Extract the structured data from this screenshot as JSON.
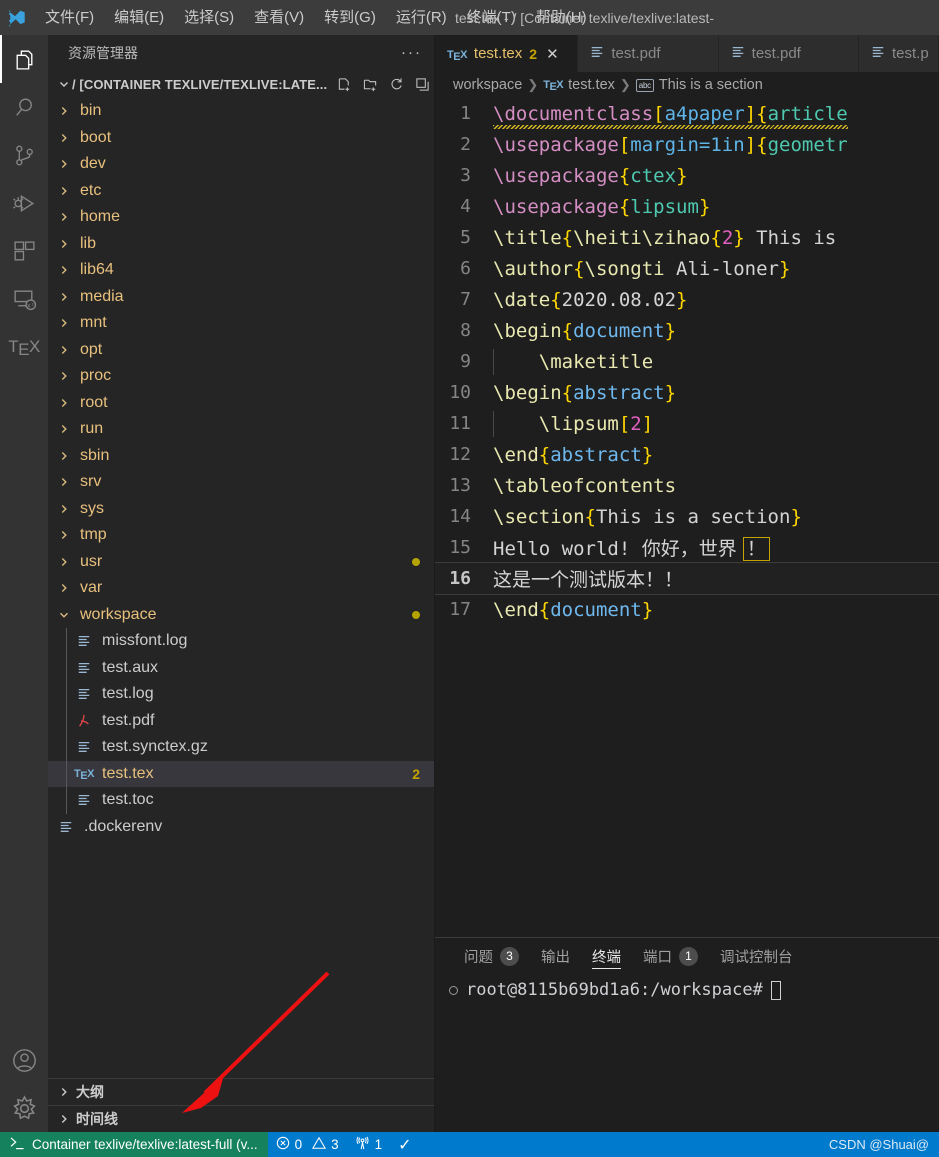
{
  "titlebar": {
    "menus": [
      {
        "label": "文件(F)",
        "mnemonic": "F"
      },
      {
        "label": "编辑(E)",
        "mnemonic": "E"
      },
      {
        "label": "选择(S)",
        "mnemonic": "S"
      },
      {
        "label": "查看(V)",
        "mnemonic": "V"
      },
      {
        "label": "转到(G)",
        "mnemonic": "G"
      },
      {
        "label": "运行(R)",
        "mnemonic": "R"
      },
      {
        "label": "终端(T)",
        "mnemonic": "T"
      },
      {
        "label": "帮助(H)",
        "mnemonic": "H"
      }
    ],
    "window_title": "test.tex - / [Container texlive/texlive:latest-"
  },
  "activitybar": {
    "items": [
      {
        "icon": "files-explorer-icon",
        "active": true
      },
      {
        "icon": "search-icon",
        "active": false
      },
      {
        "icon": "source-control-icon",
        "active": false
      },
      {
        "icon": "run-and-debug-icon",
        "active": false
      },
      {
        "icon": "extensions-icon",
        "active": false
      },
      {
        "icon": "remote-explorer-icon",
        "active": false
      },
      {
        "icon": "latex-workshop-icon",
        "active": false,
        "label": "TEX"
      }
    ],
    "bottom": [
      {
        "icon": "account-icon"
      },
      {
        "icon": "gear-icon"
      }
    ]
  },
  "sidebar": {
    "header": "资源管理器",
    "more_actions": "···",
    "root": {
      "label": "/ [CONTAINER TEXLIVE/TEXLIVE:LATE...",
      "expanded": true,
      "actions": [
        "new-file-icon",
        "new-folder-icon",
        "refresh-icon",
        "collapse-all-icon"
      ]
    },
    "tree": [
      {
        "name": "bin",
        "type": "folder",
        "expanded": false,
        "depth": 1
      },
      {
        "name": "boot",
        "type": "folder",
        "expanded": false,
        "depth": 1
      },
      {
        "name": "dev",
        "type": "folder",
        "expanded": false,
        "depth": 1
      },
      {
        "name": "etc",
        "type": "folder",
        "expanded": false,
        "depth": 1
      },
      {
        "name": "home",
        "type": "folder",
        "expanded": false,
        "depth": 1
      },
      {
        "name": "lib",
        "type": "folder",
        "expanded": false,
        "depth": 1
      },
      {
        "name": "lib64",
        "type": "folder",
        "expanded": false,
        "depth": 1
      },
      {
        "name": "media",
        "type": "folder",
        "expanded": false,
        "depth": 1
      },
      {
        "name": "mnt",
        "type": "folder",
        "expanded": false,
        "depth": 1
      },
      {
        "name": "opt",
        "type": "folder",
        "expanded": false,
        "depth": 1
      },
      {
        "name": "proc",
        "type": "folder",
        "expanded": false,
        "depth": 1
      },
      {
        "name": "root",
        "type": "folder",
        "expanded": false,
        "depth": 1
      },
      {
        "name": "run",
        "type": "folder",
        "expanded": false,
        "depth": 1
      },
      {
        "name": "sbin",
        "type": "folder",
        "expanded": false,
        "depth": 1
      },
      {
        "name": "srv",
        "type": "folder",
        "expanded": false,
        "depth": 1
      },
      {
        "name": "sys",
        "type": "folder",
        "expanded": false,
        "depth": 1
      },
      {
        "name": "tmp",
        "type": "folder",
        "expanded": false,
        "depth": 1
      },
      {
        "name": "usr",
        "type": "folder",
        "expanded": false,
        "depth": 1,
        "modified": true
      },
      {
        "name": "var",
        "type": "folder",
        "expanded": false,
        "depth": 1
      },
      {
        "name": "workspace",
        "type": "folder",
        "expanded": true,
        "depth": 1,
        "modified": true
      },
      {
        "name": "missfont.log",
        "type": "file",
        "icon": "log-file-icon",
        "depth": 2
      },
      {
        "name": "test.aux",
        "type": "file",
        "icon": "log-file-icon",
        "depth": 2
      },
      {
        "name": "test.log",
        "type": "file",
        "icon": "log-file-icon",
        "depth": 2
      },
      {
        "name": "test.pdf",
        "type": "file",
        "icon": "pdf-file-icon",
        "depth": 2
      },
      {
        "name": "test.synctex.gz",
        "type": "file",
        "icon": "log-file-icon",
        "depth": 2
      },
      {
        "name": "test.tex",
        "type": "file",
        "icon": "tex-file-icon",
        "depth": 2,
        "selected": true,
        "badge": "2"
      },
      {
        "name": "test.toc",
        "type": "file",
        "icon": "log-file-icon",
        "depth": 2
      },
      {
        "name": ".dockerenv",
        "type": "file",
        "icon": "log-file-icon",
        "depth": 1
      }
    ],
    "sections": [
      {
        "label": "大纲",
        "expanded": false
      },
      {
        "label": "时间线",
        "expanded": false
      }
    ]
  },
  "editor": {
    "tabs": [
      {
        "label": "test.tex",
        "icon": "tex-file-icon",
        "badge": "2",
        "active": true,
        "close": "✕"
      },
      {
        "label": "test.pdf",
        "icon": "log-file-icon",
        "active": false
      },
      {
        "label": "test.pdf",
        "icon": "log-file-icon",
        "active": false
      },
      {
        "label": "test.p",
        "icon": "log-file-icon",
        "active": false
      }
    ],
    "breadcrumb": [
      "workspace",
      "test.tex",
      "This is a section"
    ],
    "lines": [
      {
        "n": "1",
        "text": "\\documentclass[a4paper]{article"
      },
      {
        "n": "2",
        "text": "\\usepackage[margin=1in]{geometr"
      },
      {
        "n": "3",
        "text": "\\usepackage{ctex}"
      },
      {
        "n": "4",
        "text": "\\usepackage{lipsum}"
      },
      {
        "n": "5",
        "text": "\\title{\\heiti\\zihao{2} This is"
      },
      {
        "n": "6",
        "text": "\\author{\\songti Ali-loner}"
      },
      {
        "n": "7",
        "text": "\\date{2020.08.02}"
      },
      {
        "n": "8",
        "text": "\\begin{document}"
      },
      {
        "n": "9",
        "text": "    \\maketitle"
      },
      {
        "n": "10",
        "text": "\\begin{abstract}"
      },
      {
        "n": "11",
        "text": "    \\lipsum[2]"
      },
      {
        "n": "12",
        "text": "\\end{abstract}"
      },
      {
        "n": "13",
        "text": "\\tableofcontents"
      },
      {
        "n": "14",
        "text": "\\section{This is a section}"
      },
      {
        "n": "15",
        "text": "Hello world! 你好，世界 ！"
      },
      {
        "n": "16",
        "text": "这是一个测试版本！！",
        "current": true
      },
      {
        "n": "17",
        "text": "\\end{document}"
      }
    ]
  },
  "panel": {
    "tabs": [
      {
        "label": "问题",
        "badge": "3",
        "active": false
      },
      {
        "label": "输出",
        "badge": null,
        "active": false
      },
      {
        "label": "终端",
        "badge": null,
        "active": true
      },
      {
        "label": "端口",
        "badge": "1",
        "active": false
      },
      {
        "label": "调试控制台",
        "badge": null,
        "active": false
      }
    ],
    "terminal_prompt": "root@8115b69bd1a6:/workspace#"
  },
  "statusbar": {
    "remote": "Container texlive/texlive:latest-full (v...",
    "remote_icon": "remote-connect-icon",
    "errors": "0",
    "warnings": "3",
    "radio_count": "1",
    "check_icon": "✓",
    "watermark": "CSDN @Shuai@",
    "colors": {
      "bar": "#007acc",
      "remote": "#16825d"
    }
  }
}
